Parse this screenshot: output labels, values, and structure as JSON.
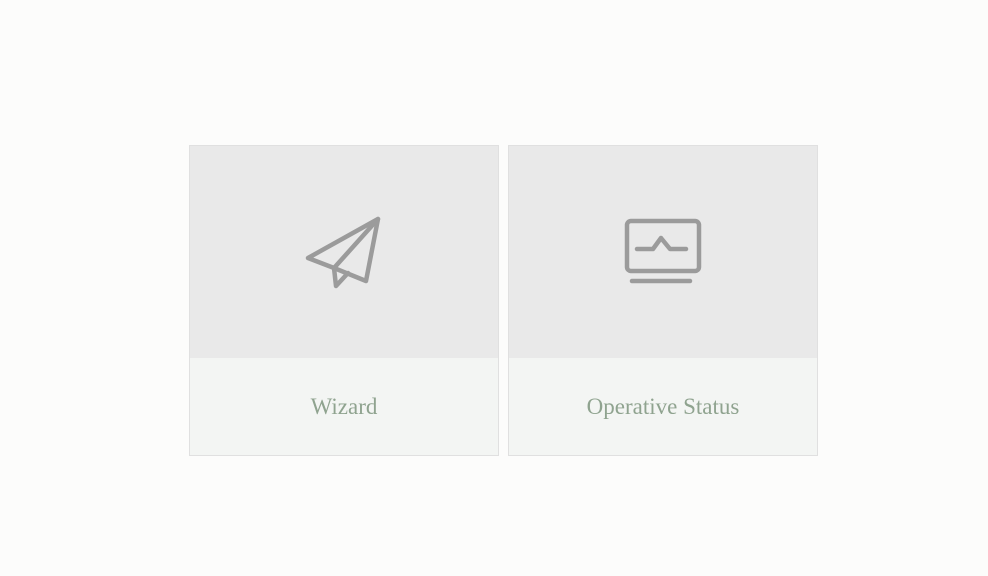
{
  "tiles": [
    {
      "label": "Wizard",
      "icon": "paper-plane-icon"
    },
    {
      "label": "Operative Status",
      "icon": "monitor-status-icon"
    }
  ],
  "colors": {
    "page_background": "#fcfcfb",
    "icon_area_background": "#e9e9e9",
    "label_area_background": "#f3f5f3",
    "label_text": "#8fa38f",
    "icon_stroke": "#9b9b9b"
  }
}
